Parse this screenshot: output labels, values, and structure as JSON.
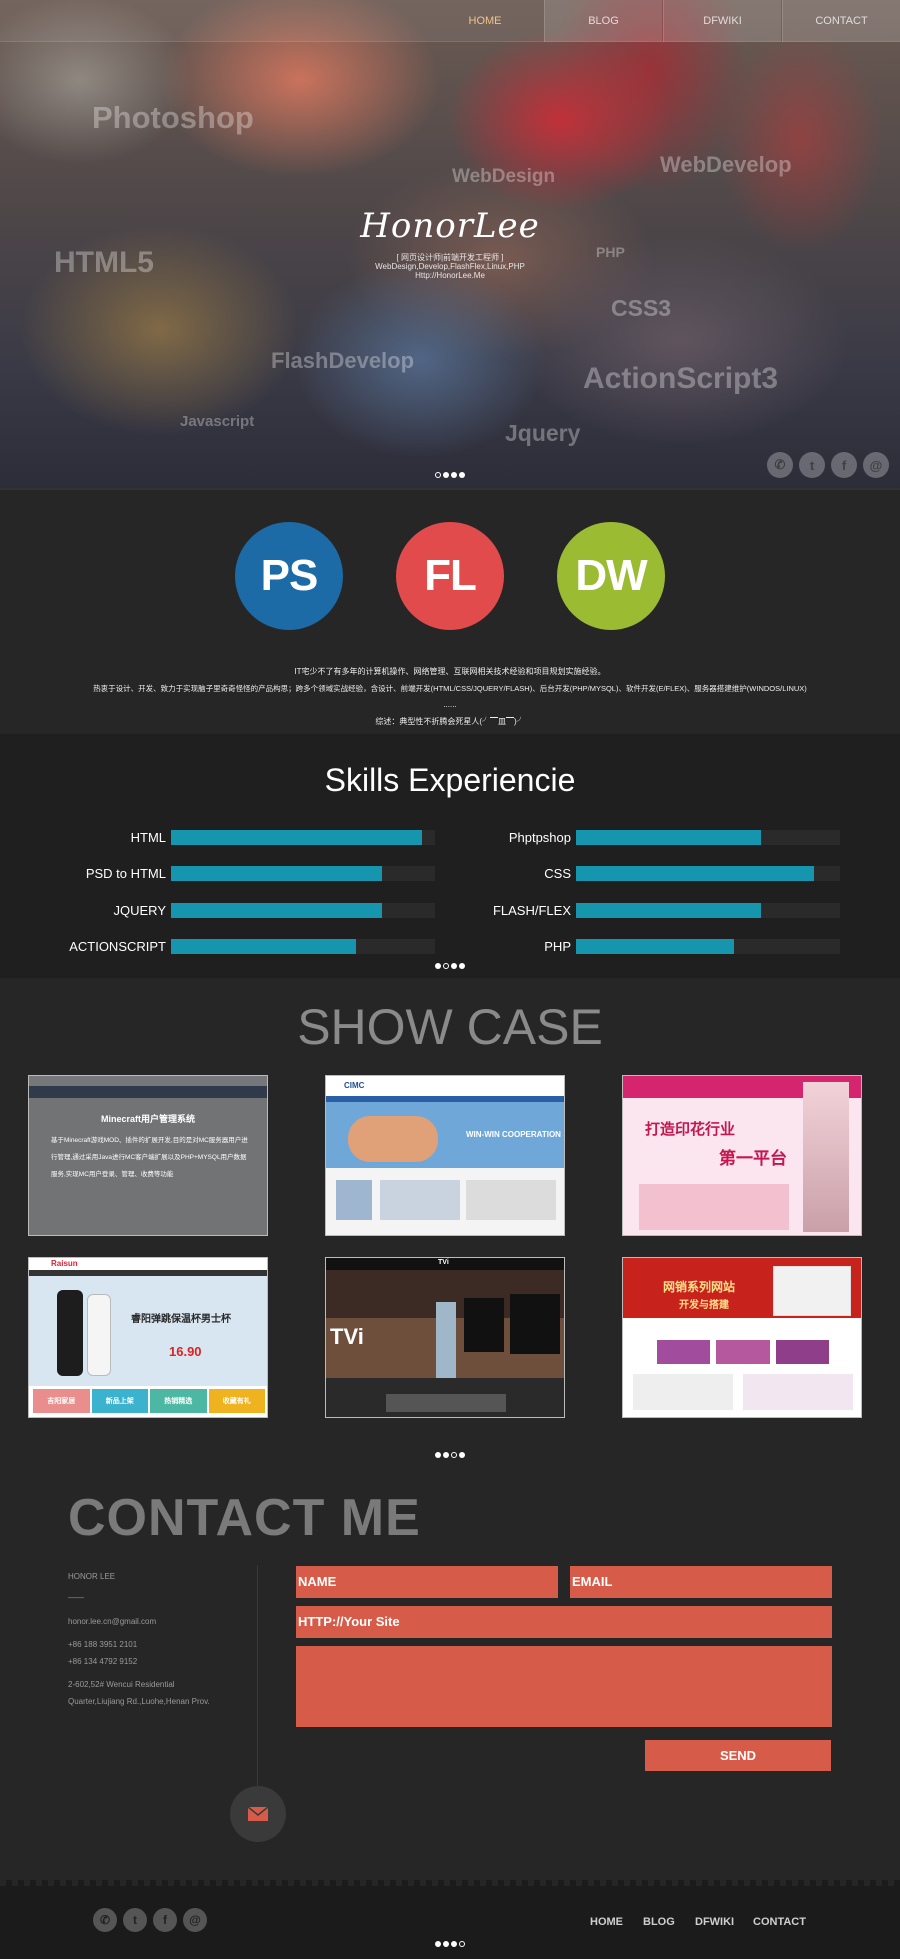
{
  "nav": {
    "items": [
      {
        "label": "HOME"
      },
      {
        "label": "BLOG"
      },
      {
        "label": "DFWIKI"
      },
      {
        "label": "CONTACT"
      }
    ]
  },
  "hero": {
    "brand": "HonorLee",
    "subtitle_line1": "[ 网页设计师|前端开发工程师 ]",
    "subtitle_line2": "WebDesign,Develop,FlashFlex,Linux,PHP",
    "subtitle_line3": "Http://HonorLee.Me",
    "tags": [
      "Photoshop",
      "WebDesign",
      "WebDevelop",
      "HTML5",
      "PHP",
      "CSS3",
      "FlashDevelop",
      "ActionScript3",
      "Javascript",
      "Jquery"
    ],
    "social_icons": [
      "wechat-icon",
      "twitter-icon",
      "facebook-icon",
      "at-icon"
    ]
  },
  "intro": {
    "badges": [
      {
        "label": "PS",
        "color": "#1c6aa6"
      },
      {
        "label": "FL",
        "color": "#e24b4b"
      },
      {
        "label": "DW",
        "color": "#9bbb32"
      }
    ],
    "line1": "IT宅少不了有多年的计算机操作、网络管理、互联网相关技术经验和项目规划实施经验。",
    "line2": "热衷于设计、开发、致力于实现脑子里奇奇怪怪的产品构思；跨多个领域实战经验，含设计、前端开发(HTML/CSS/JQUERY/FLASH)、后台开发(PHP/MYSQL)、软件开发(E/FLEX)、服务器搭建维护(WINDOS/LINUX)",
    "line3": "......",
    "line4": "综述：典型性不折腾会死星人(╯▔皿▔)╯"
  },
  "skills": {
    "title": "Skills Experiencie",
    "left": [
      {
        "label": "HTML",
        "level": 0.95
      },
      {
        "label": "PSD to HTML",
        "level": 0.8
      },
      {
        "label": "JQUERY",
        "level": 0.8
      },
      {
        "label": "ACTIONSCRIPT",
        "level": 0.7
      }
    ],
    "right": [
      {
        "label": "Phptpshop",
        "level": 0.7
      },
      {
        "label": "CSS",
        "level": 0.9
      },
      {
        "label": "FLASH/FLEX",
        "level": 0.7
      },
      {
        "label": "PHP",
        "level": 0.6
      }
    ]
  },
  "showcase": {
    "title": "SHOW CASE",
    "first_caption_title": "Minecraft用户管理系统",
    "first_caption_body": "基于Minecraft游戏MOD、插件的扩展开发,目的是对MC服务器用户进行管理,通过采用Java进行MC客户端扩展以及PHP+MYSQL用户数据服务,实现MC用户登录、管理、收费等功能",
    "thumb2_brand": "CIMC",
    "thumb2_banner": "WIN-WIN COOPERATION",
    "thumb3_title": "打造印花行业",
    "thumb3_sub": "第一平台",
    "thumb4_brand": "Raisun",
    "thumb4_title": "睿阳弹跳保温杯男士杯",
    "thumb4_price": "16.90",
    "thumb4_tabs": [
      "吉阳家居",
      "新品上架",
      "热销精选",
      "收藏有礼"
    ],
    "thumb5_brand": "TVi",
    "thumb6_title": "网销系列网站",
    "thumb6_sub": "开发与搭建"
  },
  "contact": {
    "title": "CONTACT ME",
    "name": "HONOR LEE",
    "sep": "——",
    "email": "honor.lee.cn@gmail.com",
    "phone1": "+86 188 3951 2101",
    "phone2": "+86 134 4792 9152",
    "address1": "2-602,52# Wencui Residential",
    "address2": "Quarter,Liujiang Rd.,Luohe,Henan Prov.",
    "form": {
      "name_placeholder": "NAME",
      "email_placeholder": "EMAIL",
      "site_placeholder": "HTTP://Your Site",
      "send_label": "SEND"
    }
  },
  "footer": {
    "nav": [
      "HOME",
      "BLOG",
      "DFWIKI",
      "CONTACT"
    ],
    "social_icons": [
      "wechat-icon",
      "twitter-icon",
      "facebook-icon",
      "at-icon"
    ]
  }
}
